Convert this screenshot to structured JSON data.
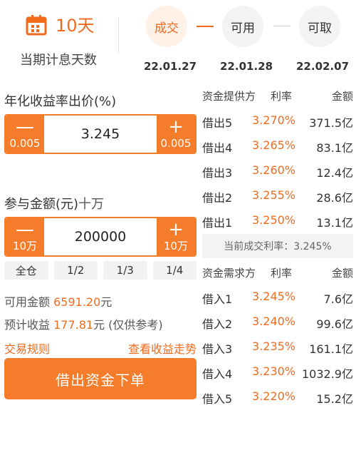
{
  "colors": {
    "accent": "#f26b1d",
    "button": "#f47c2a"
  },
  "period": {
    "icon": "calendar-icon",
    "days": "10天",
    "label": "当期计息天数"
  },
  "steps": [
    {
      "label": "成交",
      "date": "22.01.27",
      "active": true
    },
    {
      "label": "可用",
      "date": "22.01.28",
      "active": false
    },
    {
      "label": "可取",
      "date": "22.02.07",
      "active": false
    }
  ],
  "rate_section": {
    "title": "年化收益率出价(%)",
    "value": "3.245",
    "minus_unit": "0.005",
    "plus_unit": "0.005",
    "minus_symbol": "—",
    "plus_symbol": "+"
  },
  "amount_section": {
    "title": "参与金额(元)",
    "title_unit": "十万",
    "value": "200000",
    "minus_unit": "10万",
    "plus_unit": "10万",
    "minus_symbol": "—",
    "plus_symbol": "+"
  },
  "quick_amounts": [
    "全仓",
    "1/2",
    "1/3",
    "1/4"
  ],
  "available": {
    "label": "可用金额",
    "value": "6591.20",
    "unit": "元"
  },
  "expected": {
    "label": "预计收益",
    "value": "177.81",
    "unit": "元 (仅供参考)"
  },
  "links": {
    "rules": "交易规则",
    "trend": "查看收益走势"
  },
  "submit_label": "借出资金下单",
  "supply": {
    "headers": [
      "资金提供方",
      "利率",
      "金额"
    ],
    "rows": [
      [
        "借出5",
        "3.270%",
        "371.5亿"
      ],
      [
        "借出4",
        "3.265%",
        "83.1亿"
      ],
      [
        "借出3",
        "3.260%",
        "12.4亿"
      ],
      [
        "借出2",
        "3.255%",
        "28.6亿"
      ],
      [
        "借出1",
        "3.250%",
        "13.1亿"
      ]
    ]
  },
  "current_rate": "当前成交利率：3.245%",
  "demand": {
    "headers": [
      "资金需求方",
      "利率",
      "金额"
    ],
    "rows": [
      [
        "借入1",
        "3.245%",
        "7.6亿"
      ],
      [
        "借入2",
        "3.240%",
        "99.6亿"
      ],
      [
        "借入3",
        "3.235%",
        "161.1亿"
      ],
      [
        "借入4",
        "3.230%",
        "1032.9亿"
      ],
      [
        "借入5",
        "3.220%",
        "15.2亿"
      ]
    ]
  }
}
